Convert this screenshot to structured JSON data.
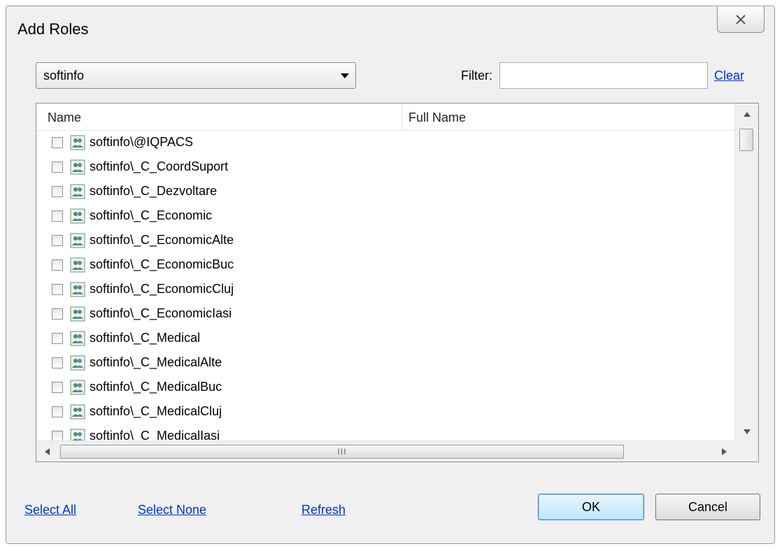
{
  "dialog": {
    "title": "Add Roles"
  },
  "toolbar": {
    "domain_selected": "softinfo",
    "filter_label": "Filter:",
    "filter_value": "",
    "clear_label": "Clear"
  },
  "list": {
    "columns": {
      "name": "Name",
      "full_name": "Full Name"
    },
    "rows": [
      {
        "name": "softinfo\\@IQPACS",
        "full_name": "",
        "checked": false
      },
      {
        "name": "softinfo\\_C_CoordSuport",
        "full_name": "",
        "checked": false
      },
      {
        "name": "softinfo\\_C_Dezvoltare",
        "full_name": "",
        "checked": false
      },
      {
        "name": "softinfo\\_C_Economic",
        "full_name": "",
        "checked": false
      },
      {
        "name": "softinfo\\_C_EconomicAlte",
        "full_name": "",
        "checked": false
      },
      {
        "name": "softinfo\\_C_EconomicBuc",
        "full_name": "",
        "checked": false
      },
      {
        "name": "softinfo\\_C_EconomicCluj",
        "full_name": "",
        "checked": false
      },
      {
        "name": "softinfo\\_C_EconomicIasi",
        "full_name": "",
        "checked": false
      },
      {
        "name": "softinfo\\_C_Medical",
        "full_name": "",
        "checked": false
      },
      {
        "name": "softinfo\\_C_MedicalAlte",
        "full_name": "",
        "checked": false
      },
      {
        "name": "softinfo\\_C_MedicalBuc",
        "full_name": "",
        "checked": false
      },
      {
        "name": "softinfo\\_C_MedicalCluj",
        "full_name": "",
        "checked": false
      },
      {
        "name": "softinfo\\_C_MedicalIasi",
        "full_name": "",
        "checked": false
      }
    ],
    "horizontal_scroll_grip": "III"
  },
  "footer": {
    "select_all": "Select All",
    "select_none": "Select None",
    "refresh": "Refresh",
    "ok": "OK",
    "cancel": "Cancel"
  },
  "icons": {
    "close": "close-icon",
    "dropdown": "chevron-down-icon",
    "role": "role-group-icon",
    "scroll_up": "arrow-up-icon",
    "scroll_down": "arrow-down-icon",
    "scroll_left": "arrow-left-icon",
    "scroll_right": "arrow-right-icon"
  },
  "colors": {
    "link": "#0033cc",
    "ok_button_accent": "#3c7fb1"
  }
}
